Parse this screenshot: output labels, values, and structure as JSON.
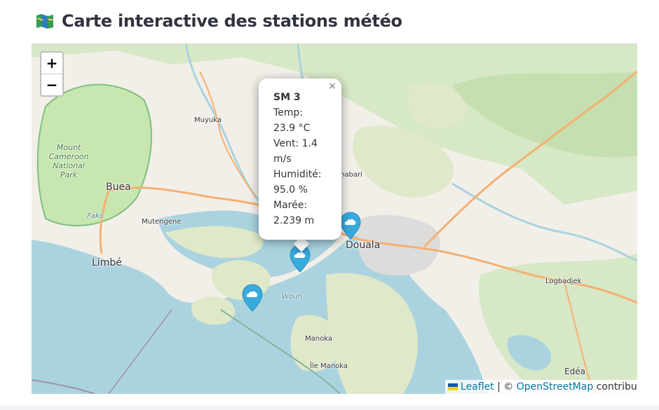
{
  "header": {
    "icon": "map-icon",
    "title": "Carte interactive des stations météo"
  },
  "map": {
    "zoom_in_label": "+",
    "zoom_out_label": "−",
    "places": {
      "muyuka": "Muyuka",
      "mount_cameroon": "Mount Cameroon National Park",
      "buea": "Buea",
      "fako": "Fako",
      "mutengene": "Mutengene",
      "limbe": "Limbé",
      "douala": "Douala",
      "bonabari": "nabari",
      "wouri": "Wouri",
      "manoka": "Manoka",
      "ile_manoka": "Île Manoka",
      "logbadjek": "Logbadjek",
      "edea": "Edéa"
    },
    "markers": [
      {
        "icon": "cloud-icon",
        "color": "#38aadd"
      },
      {
        "icon": "cloud-icon",
        "color": "#38aadd"
      },
      {
        "icon": "cloud-icon",
        "color": "#38aadd"
      }
    ],
    "popup": {
      "close": "×",
      "station": "SM 3",
      "lines": [
        "Temp:",
        "23.9 °C",
        "Vent: 1.4",
        "m/s",
        "Humidité:",
        "95.0 %",
        "Marée:",
        "2.239 m"
      ]
    },
    "attribution": {
      "leaflet": "Leaflet",
      "separator": " | © ",
      "osm": "OpenStreetMap",
      "contrib": " contribu"
    }
  },
  "colors": {
    "water": "#aad3df",
    "land": "#f2efe9",
    "forest": "#add19e",
    "park": "#c8e6b0",
    "mangrove": "#dfe8c8",
    "road": "#f5b071",
    "marker": "#38aadd"
  }
}
